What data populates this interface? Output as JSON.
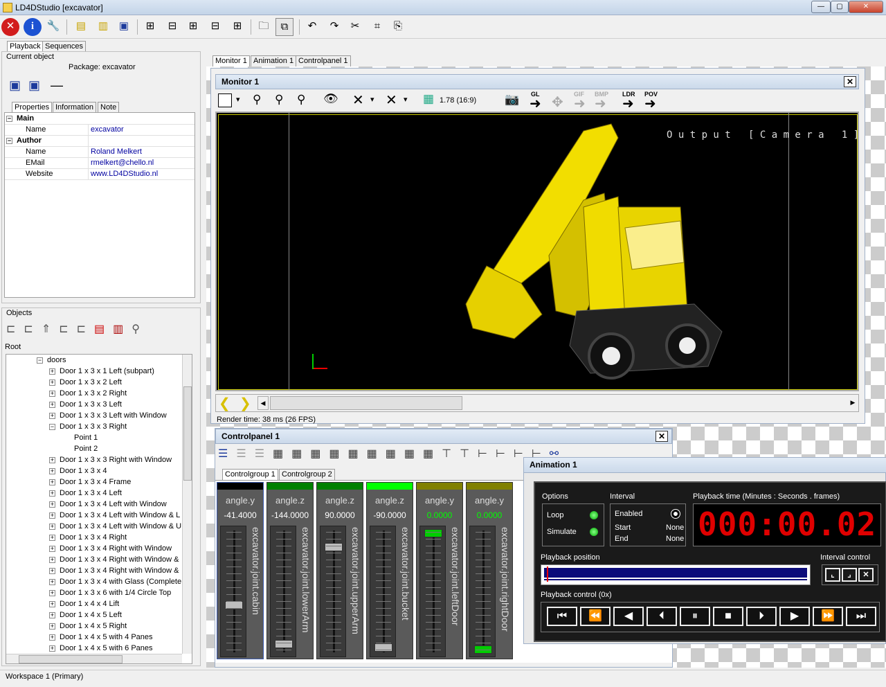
{
  "window": {
    "title": "LD4DStudio [excavator]"
  },
  "toolbar": {
    "icons": [
      "close-icon",
      "info-icon",
      "wrench-icon",
      "new-sequence-icon",
      "edit-icon",
      "save-icon",
      "add-object-icon",
      "add-camera-icon",
      "add-light-icon",
      "add-group-icon",
      "add-control-icon",
      "open-folder-icon",
      "folder-window-icon",
      "undo-icon",
      "redo-icon",
      "cut-icon",
      "crop-icon",
      "paste-icon"
    ]
  },
  "left_tabs": [
    "Playback",
    "Sequences"
  ],
  "current_object": {
    "label": "Current object",
    "package": "Package: excavator"
  },
  "prop_tabs": [
    "Properties",
    "Information",
    "Note"
  ],
  "properties": {
    "main_header": "Main",
    "author_header": "Author",
    "rows": [
      {
        "key": "Name",
        "value": "excavator"
      },
      {
        "key": "Name",
        "value": "Roland Melkert"
      },
      {
        "key": "EMail",
        "value": "rmelkert@chello.nl"
      },
      {
        "key": "Website",
        "value": "www.LD4DStudio.nl"
      }
    ]
  },
  "objects": {
    "label": "Objects",
    "root": "Root",
    "folder": "doors",
    "items": [
      "Door 1 x 3 x 1 Left (subpart)",
      "Door 1 x 3 x 2 Left",
      "Door 1 x 3 x 2 Right",
      "Door 1 x 3 x 3 Left",
      "Door 1 x 3 x 3 Left with Window",
      "Door 1 x 3 x 3 Right",
      "Point 1",
      "Point 2",
      "Door 1 x 3 x 3 Right with Window",
      "Door 1 x 3 x 4",
      "Door 1 x 3 x 4 Frame",
      "Door 1 x 3 x 4 Left",
      "Door 1 x 3 x 4 Left with Window",
      "Door 1 x 3 x 4 Left with Window & L",
      "Door 1 x 3 x 4 Left with Window & U",
      "Door 1 x 3 x 4 Right",
      "Door 1 x 3 x 4 Right with Window",
      "Door 1 x 3 x 4 Right with Window &",
      "Door 1 x 3 x 4 Right with Window &",
      "Door 1 x 3 x 4 with Glass (Complete",
      "Door 1 x 3 x 6 with 1/4 Circle Top",
      "Door 1 x 4 x 4 Lift",
      "Door 1 x 4 x 5 Left",
      "Door 1 x 4 x 5 Right",
      "Door 1 x 4 x 5 with 4 Panes",
      "Door 1 x 4 x 5 with 6 Panes"
    ]
  },
  "doc_tabs": [
    "Monitor 1",
    "Animation 1",
    "Controlpanel 1"
  ],
  "monitor": {
    "title": "Monitor 1",
    "aspect": "1.78 (16:9)",
    "render_labels": [
      "GL",
      "GIF",
      "BMP",
      "LDR",
      "POV"
    ],
    "overlay": "O u t p u t   [ C a m e r a   1 ]",
    "render_time": "Render time: 38 ms (26 FPS)"
  },
  "controlpanel": {
    "title": "Controlpanel 1",
    "group_tabs": [
      "Controlgroup 1",
      "Controlgroup 2"
    ],
    "strips": [
      {
        "name": "angle.y",
        "value": "-41.4000",
        "label": "excavator.joint.cabin",
        "color": "#000000",
        "knob_pos": 0.62,
        "value_color": "#ffffff",
        "knob_color": "#bdbdbd"
      },
      {
        "name": "angle.z",
        "value": "-144.0000",
        "label": "excavator.joint.lowerArm",
        "color": "#008000",
        "knob_pos": 0.95,
        "value_color": "#ffffff",
        "knob_color": "#bdbdbd"
      },
      {
        "name": "angle.z",
        "value": "90.0000",
        "label": "excavator.joint.upperArm",
        "color": "#008000",
        "knob_pos": 0.12,
        "value_color": "#ffffff",
        "knob_color": "#bdbdbd"
      },
      {
        "name": "angle.z",
        "value": "-90.0000",
        "label": "excavator.joint.bucket",
        "color": "#00ff00",
        "knob_pos": 0.98,
        "value_color": "#ffffff",
        "knob_color": "#bdbdbd"
      },
      {
        "name": "angle.y",
        "value": "0.0000",
        "label": "excavator.joint.leftDoor",
        "color": "#808000",
        "knob_pos": 0.0,
        "value_color": "#00ff00",
        "knob_color": "#00cc00"
      },
      {
        "name": "angle.y",
        "value": "0.0000",
        "label": "excavator.joint.rightDoor",
        "color": "#808000",
        "knob_pos": 1.0,
        "value_color": "#00ff00",
        "knob_color": "#00cc00"
      }
    ]
  },
  "animation": {
    "title": "Animation 1",
    "options_label": "Options",
    "loop": "Loop",
    "simulate": "Simulate",
    "interval_label": "Interval",
    "enabled": "Enabled",
    "start": "Start",
    "start_value": "None",
    "end": "End",
    "end_value": "None",
    "playback_time_label": "Playback time (Minutes : Seconds . frames)",
    "time": "000:00.02",
    "playback_position_label": "Playback position",
    "interval_control_label": "Interval control",
    "playback_control_label": "Playback control (0x)",
    "position": 0.01
  },
  "status": {
    "workspace": "Workspace 1 (Primary)"
  }
}
